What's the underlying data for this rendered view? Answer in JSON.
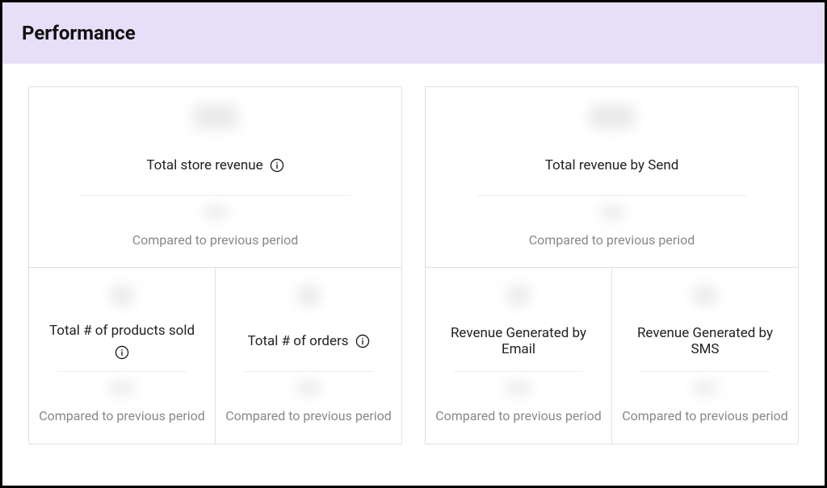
{
  "header": {
    "title": "Performance"
  },
  "compared_label": "Compared to previous period",
  "left": {
    "top": {
      "label": "Total store revenue",
      "has_info": true
    },
    "cells": [
      {
        "label": "Total # of products sold",
        "has_info": true
      },
      {
        "label": "Total # of orders",
        "has_info": true
      }
    ]
  },
  "right": {
    "top": {
      "label": "Total revenue by Send",
      "has_info": false
    },
    "cells": [
      {
        "label": "Revenue Generated by Email",
        "has_info": false
      },
      {
        "label": "Revenue Generated by SMS",
        "has_info": false
      }
    ]
  }
}
